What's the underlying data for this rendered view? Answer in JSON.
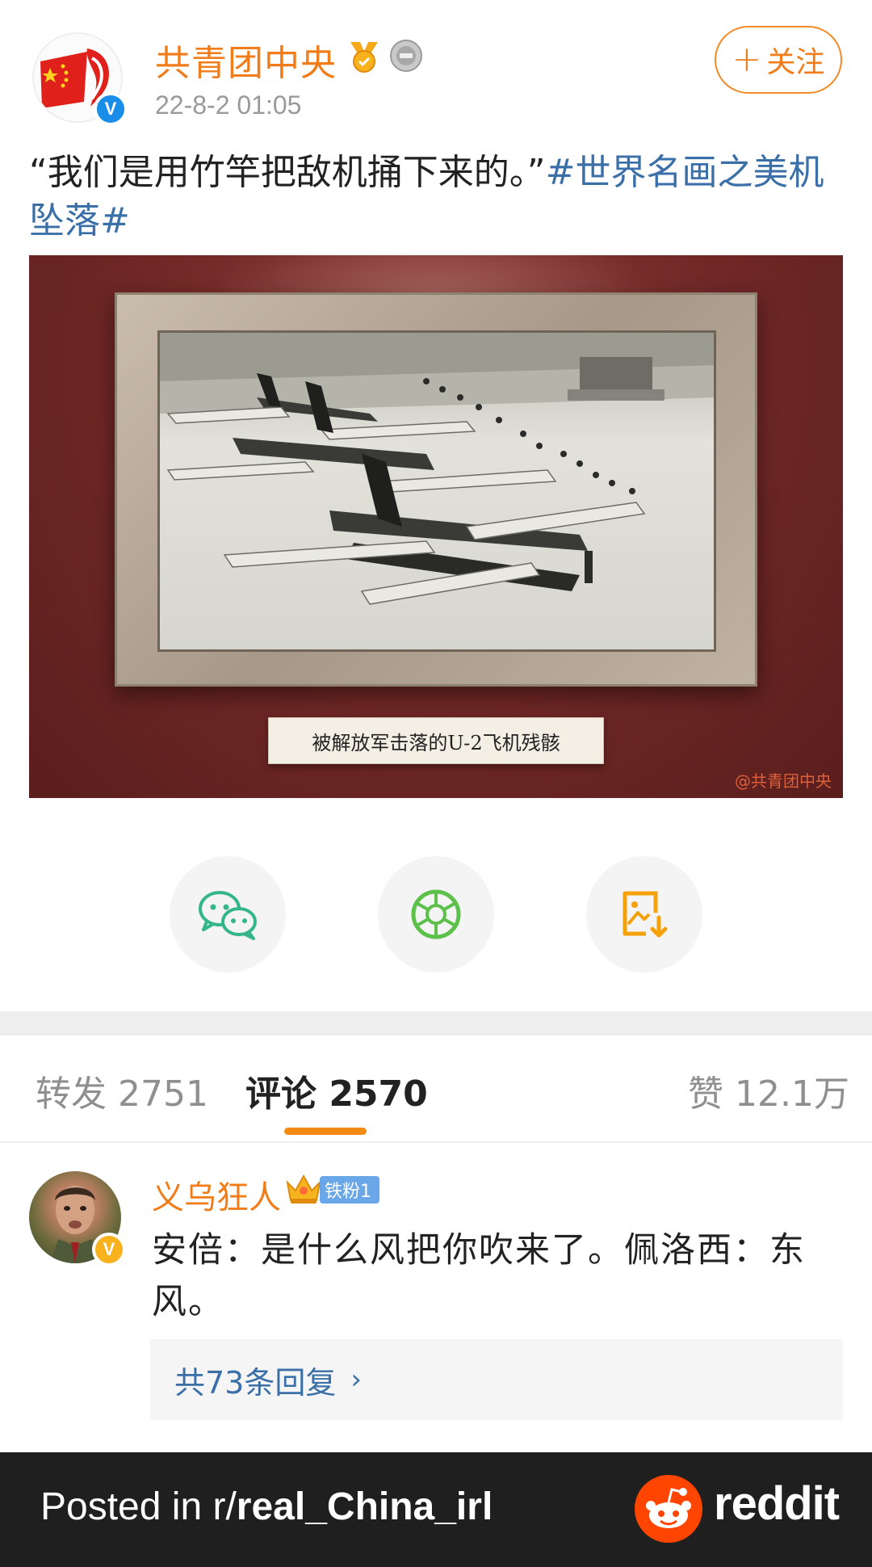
{
  "post": {
    "author": "共青团中央",
    "time": "22-8-2 01:05",
    "follow_label": "关注",
    "text_main": "“我们是用竹竿把敌机捅下来的。”",
    "text_tag": "#世界名画之美机坠落#",
    "image_caption": "被解放军击落的U-2飞机残骸",
    "image_watermark": "@共青团中央"
  },
  "share": [
    {
      "icon": "wechat-icon"
    },
    {
      "icon": "moments-icon"
    },
    {
      "icon": "save-image-icon"
    }
  ],
  "tabs": {
    "repost": "转发 2751",
    "comments": "评论 2570",
    "likes": "赞 12.1万"
  },
  "comment": {
    "author": "义乌狂人",
    "fan_badge": "铁粉1",
    "text": "安倍：是什么风把你吹来了。佩洛西：东风。",
    "replies": "共73条回复"
  },
  "footer": {
    "prefix": "Posted in r/",
    "subreddit": "real_China_irl",
    "brand": "reddit"
  },
  "colors": {
    "accent_orange": "#f07d1a",
    "link_blue": "#3b6fa8",
    "tab_underline": "#f28a14",
    "reddit_orange": "#ff4500"
  }
}
